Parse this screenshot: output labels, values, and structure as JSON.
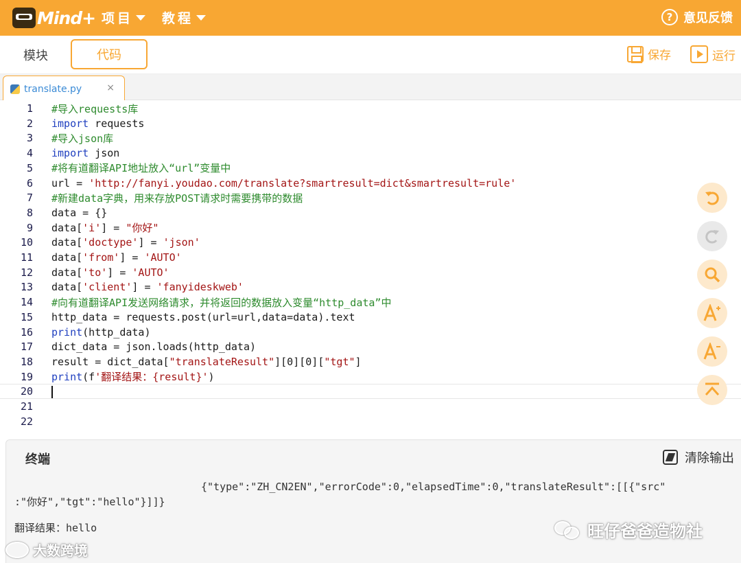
{
  "app": {
    "logo_text": "Mind+",
    "menu": [
      {
        "label": "项目"
      },
      {
        "label": "教程"
      }
    ],
    "feedback_label": "意见反馈",
    "brand_color": "#f8a733"
  },
  "mode_tabs": {
    "blocks_label": "模块",
    "code_label": "代码",
    "active": "代码"
  },
  "toolbar": {
    "save_label": "保存",
    "run_label": "运行"
  },
  "file_tab": {
    "name": "translate.py",
    "close_glyph": "×"
  },
  "editor": {
    "line_numbers": [
      "1",
      "2",
      "3",
      "4",
      "5",
      "6",
      "7",
      "8",
      "9",
      "10",
      "11",
      "12",
      "13",
      "14",
      "15",
      "16",
      "17",
      "18",
      "19",
      "20",
      "21",
      "22"
    ],
    "active_line": 20,
    "lines": [
      [
        {
          "t": "#导入requests库",
          "c": "com"
        }
      ],
      [
        {
          "t": "import",
          "c": "kw"
        },
        {
          "t": " requests",
          "c": "pl"
        }
      ],
      [
        {
          "t": "#导入json库",
          "c": "com"
        }
      ],
      [
        {
          "t": "import",
          "c": "kw"
        },
        {
          "t": " json",
          "c": "pl"
        }
      ],
      [
        {
          "t": "#将有道翻译API地址放入“url”变量中",
          "c": "com"
        }
      ],
      [
        {
          "t": "url = ",
          "c": "pl"
        },
        {
          "t": "'http://fanyi.youdao.com/translate?smartresult=dict&smartresult=rule'",
          "c": "str"
        }
      ],
      [
        {
          "t": "#新建data字典，用来存放POST请求时需要携带的数据",
          "c": "com"
        }
      ],
      [
        {
          "t": "data = {}",
          "c": "pl"
        }
      ],
      [
        {
          "t": "data[",
          "c": "pl"
        },
        {
          "t": "'i'",
          "c": "str"
        },
        {
          "t": "] = ",
          "c": "pl"
        },
        {
          "t": "\"你好\"",
          "c": "str"
        }
      ],
      [
        {
          "t": "data[",
          "c": "pl"
        },
        {
          "t": "'doctype'",
          "c": "str"
        },
        {
          "t": "] = ",
          "c": "pl"
        },
        {
          "t": "'json'",
          "c": "str"
        }
      ],
      [
        {
          "t": "data[",
          "c": "pl"
        },
        {
          "t": "'from'",
          "c": "str"
        },
        {
          "t": "] = ",
          "c": "pl"
        },
        {
          "t": "'AUTO'",
          "c": "str"
        }
      ],
      [
        {
          "t": "data[",
          "c": "pl"
        },
        {
          "t": "'to'",
          "c": "str"
        },
        {
          "t": "] = ",
          "c": "pl"
        },
        {
          "t": "'AUTO'",
          "c": "str"
        }
      ],
      [
        {
          "t": "data[",
          "c": "pl"
        },
        {
          "t": "'client'",
          "c": "str"
        },
        {
          "t": "] = ",
          "c": "pl"
        },
        {
          "t": "'fanyideskweb'",
          "c": "str"
        }
      ],
      [
        {
          "t": "#向有道翻译API发送网络请求，并将返回的数据放入变量“http_data”中",
          "c": "com"
        }
      ],
      [
        {
          "t": "http_data = requests.post(url=url,data=data).text",
          "c": "pl"
        }
      ],
      [
        {
          "t": "print",
          "c": "kw"
        },
        {
          "t": "(http_data)",
          "c": "pl"
        }
      ],
      [
        {
          "t": "dict_data = json.loads(http_data)",
          "c": "pl"
        }
      ],
      [
        {
          "t": "result = dict_data[",
          "c": "pl"
        },
        {
          "t": "\"translateResult\"",
          "c": "str"
        },
        {
          "t": "][0][0][",
          "c": "pl"
        },
        {
          "t": "\"tgt\"",
          "c": "str"
        },
        {
          "t": "]",
          "c": "pl"
        }
      ],
      [
        {
          "t": "print",
          "c": "kw"
        },
        {
          "t": "(f",
          "c": "pl"
        },
        {
          "t": "'翻译结果：{result}'",
          "c": "str"
        },
        {
          "t": ")",
          "c": "pl"
        }
      ],
      [],
      [],
      []
    ]
  },
  "side_tools": [
    {
      "name": "undo-icon",
      "enabled": true
    },
    {
      "name": "redo-icon",
      "enabled": false
    },
    {
      "name": "search-icon",
      "enabled": true
    },
    {
      "name": "font-increase-icon",
      "enabled": true
    },
    {
      "name": "font-decrease-icon",
      "enabled": true
    },
    {
      "name": "scroll-top-icon",
      "enabled": true
    }
  ],
  "terminal": {
    "title": "终端",
    "clear_label": "清除输出",
    "output": [
      "{\"type\":\"ZH_CN2EN\",\"errorCode\":0,\"elapsedTime\":0,\"translateResult\":[[{\"src\"",
      ":\"你好\",\"tgt\":\"hello\"}]]}",
      "翻译结果：hello"
    ]
  },
  "watermarks": {
    "right": "旺仔爸爸造物社",
    "left": "大数跨境"
  }
}
